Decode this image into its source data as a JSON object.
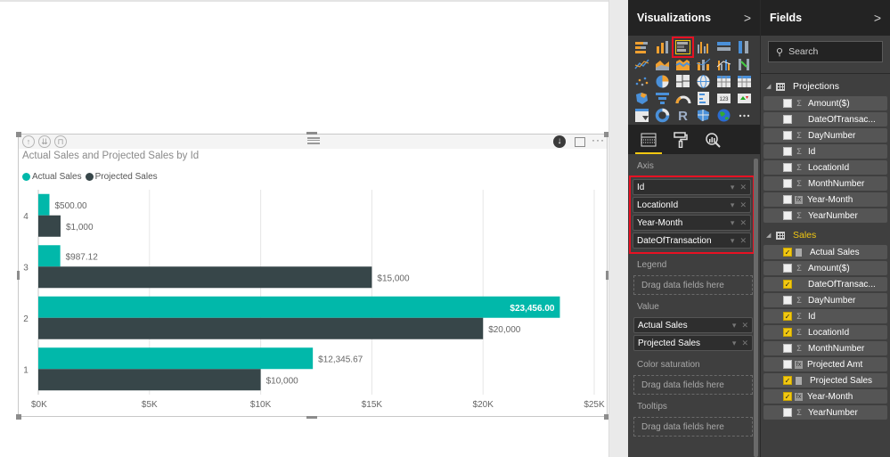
{
  "visual": {
    "header_icons": [
      "drill-up-icon",
      "drill-down-all-icon",
      "expand-hierarchy-icon"
    ],
    "export_icon": "download-icon",
    "focus_icon": "focus-mode-icon",
    "more_label": "···"
  },
  "chart_data": {
    "type": "bar",
    "orientation": "horizontal",
    "title": "Actual Sales and Projected Sales by Id",
    "categories": [
      "4",
      "3",
      "2",
      "1"
    ],
    "series": [
      {
        "name": "Actual Sales",
        "color": "#01b8aa",
        "values": [
          500.0,
          987.12,
          23456.0,
          12345.67
        ],
        "labels": [
          "$500.00",
          "$987.12",
          "$23,456.00",
          "$12,345.67"
        ]
      },
      {
        "name": "Projected Sales",
        "color": "#374649",
        "values": [
          1000,
          15000,
          20000,
          10000
        ],
        "labels": [
          "$1,000",
          "$15,000",
          "$20,000",
          "$10,000"
        ]
      }
    ],
    "xlim": [
      0,
      25000
    ],
    "xticks": [
      0,
      5000,
      10000,
      15000,
      20000,
      25000
    ],
    "xtick_labels": [
      "$0K",
      "$5K",
      "$10K",
      "$15K",
      "$20K",
      "$25K"
    ],
    "xlabel": "",
    "ylabel": "",
    "grid": true,
    "legend_position": "top-left"
  },
  "viz_pane": {
    "title": "Visualizations",
    "collapse_icon": ">",
    "icons": [
      "stacked-bar-chart",
      "stacked-column-chart",
      "clustered-bar-chart",
      "clustered-column-chart",
      "100-stacked-bar-chart",
      "100-stacked-column-chart",
      "line-chart",
      "area-chart",
      "stacked-area-chart",
      "line-and-stacked-column-chart",
      "line-and-clustered-column-chart",
      "ribbon-chart",
      "scatter-chart",
      "pie-chart",
      "treemap",
      "map",
      "table",
      "matrix",
      "filled-map",
      "funnel",
      "gauge",
      "multi-row-card",
      "card",
      "kpi",
      "slicer",
      "donut-chart",
      "r-script-visual",
      "shape-map",
      "globe-map",
      "more-visuals"
    ],
    "selected_icon": "clustered-bar-chart",
    "tabs": [
      "fields-tab",
      "format-tab",
      "analytics-tab"
    ],
    "wells": {
      "axis_label": "Axis",
      "axis_fields": [
        "Id",
        "LocationId",
        "Year-Month",
        "DateOfTransaction"
      ],
      "legend_label": "Legend",
      "value_label": "Value",
      "value_fields": [
        "Actual Sales",
        "Projected Sales"
      ],
      "color_saturation_label": "Color saturation",
      "tooltips_label": "Tooltips",
      "drop_placeholder": "Drag data fields here"
    }
  },
  "fields_pane": {
    "title": "Fields",
    "collapse_icon": ">",
    "search_placeholder": "Search",
    "tables": [
      {
        "name": "Projections",
        "active": false,
        "fields": [
          {
            "name": "Amount($)",
            "type": "sum",
            "checked": false
          },
          {
            "name": "DateOfTransac...",
            "type": "none",
            "checked": false
          },
          {
            "name": "DayNumber",
            "type": "sum",
            "checked": false
          },
          {
            "name": "Id",
            "type": "sum",
            "checked": false
          },
          {
            "name": "LocationId",
            "type": "sum",
            "checked": false
          },
          {
            "name": "MonthNumber",
            "type": "sum",
            "checked": false
          },
          {
            "name": "Year-Month",
            "type": "hierarchy",
            "checked": false
          },
          {
            "name": "YearNumber",
            "type": "sum",
            "checked": false
          }
        ]
      },
      {
        "name": "Sales",
        "active": true,
        "fields": [
          {
            "name": "Actual Sales",
            "type": "calc",
            "checked": true
          },
          {
            "name": "Amount($)",
            "type": "sum",
            "checked": false
          },
          {
            "name": "DateOfTransac...",
            "type": "none",
            "checked": true
          },
          {
            "name": "DayNumber",
            "type": "sum",
            "checked": false
          },
          {
            "name": "Id",
            "type": "sum",
            "checked": true
          },
          {
            "name": "LocationId",
            "type": "sum",
            "checked": true
          },
          {
            "name": "MonthNumber",
            "type": "sum",
            "checked": false
          },
          {
            "name": "Projected Amt",
            "type": "hierarchy",
            "checked": false
          },
          {
            "name": "Projected Sales",
            "type": "calc",
            "checked": true
          },
          {
            "name": "Year-Month",
            "type": "hierarchy",
            "checked": true
          },
          {
            "name": "YearNumber",
            "type": "sum",
            "checked": false
          }
        ]
      }
    ]
  },
  "colors": {
    "accent_yellow": "#f2c811",
    "highlight_red": "#e81123",
    "actual_teal": "#01b8aa",
    "projected_dark": "#374649"
  }
}
